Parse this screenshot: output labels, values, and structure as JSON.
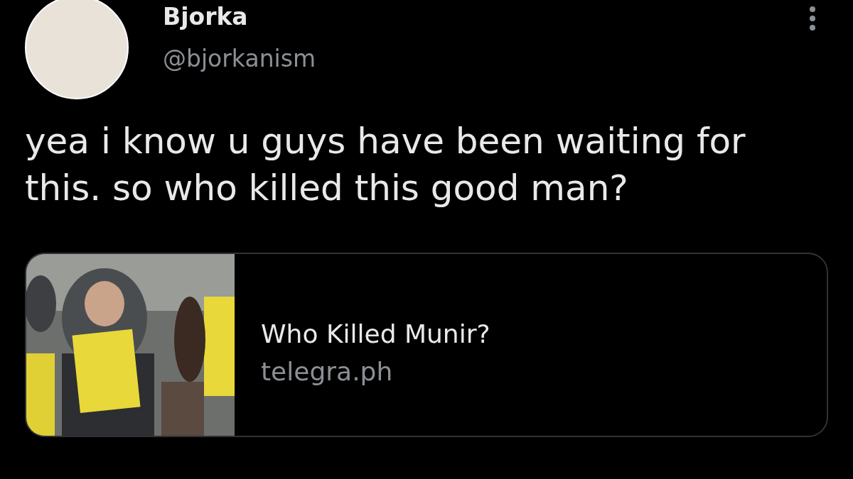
{
  "author": {
    "name": "Bjorka",
    "handle": "@bjorkanism"
  },
  "tweet": {
    "text": "yea i know u guys have been waiting for this. so who killed this good man?"
  },
  "link_card": {
    "title": "Who Killed Munir?",
    "domain": "telegra.ph"
  }
}
